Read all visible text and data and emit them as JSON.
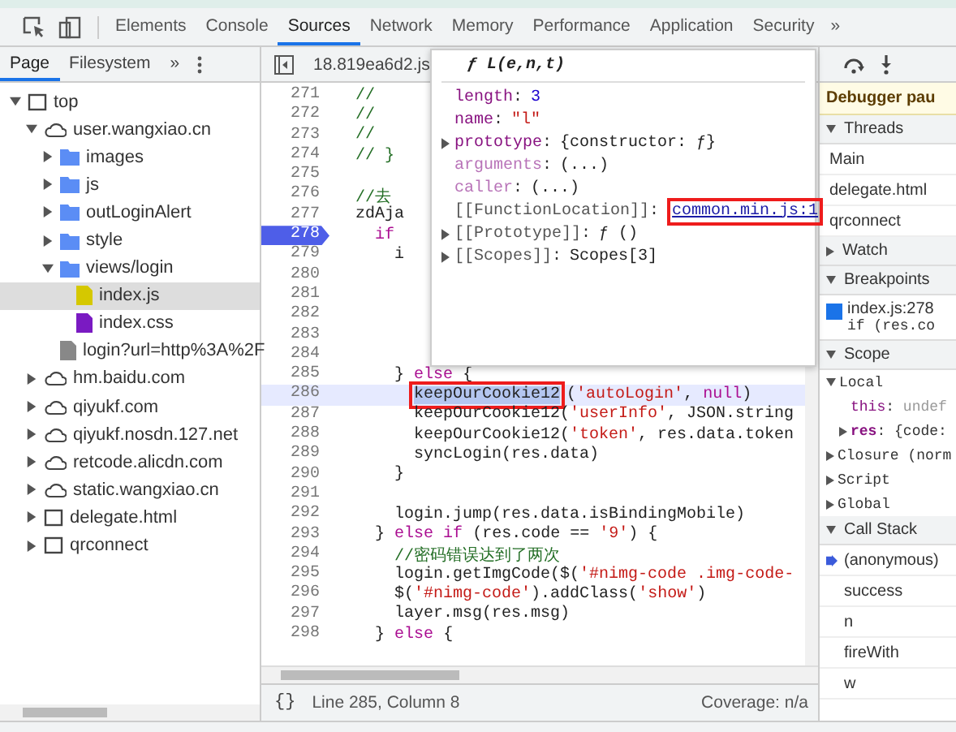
{
  "main_tabs": [
    {
      "label": "Elements",
      "selected": false
    },
    {
      "label": "Console",
      "selected": false
    },
    {
      "label": "Sources",
      "selected": true
    },
    {
      "label": "Network",
      "selected": false
    },
    {
      "label": "Memory",
      "selected": false
    },
    {
      "label": "Performance",
      "selected": false
    },
    {
      "label": "Application",
      "selected": false
    },
    {
      "label": "Security",
      "selected": false
    }
  ],
  "more_tabs": "»",
  "navigator": {
    "tabs": [
      {
        "label": "Page",
        "selected": true
      },
      {
        "label": "Filesystem",
        "selected": false
      }
    ],
    "more": "»",
    "tree": [
      {
        "label": "top",
        "kind": "frame",
        "expanded": true,
        "selected": false,
        "children": [
          {
            "label": "user.wangxiao.cn",
            "kind": "domain",
            "expanded": true,
            "selected": false,
            "children": [
              {
                "label": "images",
                "kind": "folder",
                "expanded": false,
                "selected": false
              },
              {
                "label": "js",
                "kind": "folder",
                "expanded": false,
                "selected": false
              },
              {
                "label": "outLoginAlert",
                "kind": "folder",
                "expanded": false,
                "selected": false
              },
              {
                "label": "style",
                "kind": "folder",
                "expanded": false,
                "selected": false
              },
              {
                "label": "views/login",
                "kind": "folder",
                "expanded": true,
                "selected": false,
                "children": [
                  {
                    "label": "index.js",
                    "kind": "script",
                    "selected": true
                  },
                  {
                    "label": "index.css",
                    "kind": "stylesheet",
                    "selected": false
                  }
                ]
              },
              {
                "label": "login?url=http%3A%2F",
                "kind": "document",
                "selected": false
              }
            ]
          },
          {
            "label": "hm.baidu.com",
            "kind": "domain",
            "expanded": false,
            "selected": false
          },
          {
            "label": "qiyukf.com",
            "kind": "domain",
            "expanded": false,
            "selected": false
          },
          {
            "label": "qiyukf.nosdn.127.net",
            "kind": "domain",
            "expanded": false,
            "selected": false
          },
          {
            "label": "retcode.alicdn.com",
            "kind": "domain",
            "expanded": false,
            "selected": false
          },
          {
            "label": "static.wangxiao.cn",
            "kind": "domain",
            "expanded": false,
            "selected": false
          },
          {
            "label": "delegate.html",
            "kind": "frame",
            "expanded": false,
            "selected": false
          },
          {
            "label": "qrconnect",
            "kind": "frame",
            "expanded": false,
            "selected": false
          }
        ]
      }
    ]
  },
  "editor": {
    "file_tab": "18.819ea6d2.js",
    "lines": [
      {
        "n": "271",
        "breakpoint": false,
        "highlighted": false,
        "tokens": [
          {
            "t": "//",
            "kind": "comment"
          }
        ]
      },
      {
        "n": "272",
        "breakpoint": false,
        "highlighted": false,
        "tokens": [
          {
            "t": "//",
            "kind": "comment"
          }
        ]
      },
      {
        "n": "273",
        "breakpoint": false,
        "highlighted": false,
        "tokens": [
          {
            "t": "//",
            "kind": "comment"
          }
        ]
      },
      {
        "n": "274",
        "breakpoint": false,
        "highlighted": false,
        "tokens": [
          {
            "t": "// }",
            "kind": "comment"
          }
        ]
      },
      {
        "n": "275",
        "breakpoint": false,
        "highlighted": false
      },
      {
        "n": "276",
        "breakpoint": false,
        "highlighted": false,
        "tokens": [
          {
            "t": "//去",
            "kind": "comment"
          }
        ]
      },
      {
        "n": "277",
        "breakpoint": false,
        "highlighted": false,
        "tokens": [
          {
            "t": "zdAja",
            "kind": "plain"
          }
        ]
      },
      {
        "n": "278",
        "breakpoint": true,
        "highlighted": false,
        "tokens": [
          {
            "t": "  if",
            "kind": "keyword"
          }
        ]
      },
      {
        "n": "279",
        "breakpoint": false,
        "highlighted": false,
        "tokens": [
          {
            "t": "    i",
            "kind": "plain"
          }
        ]
      },
      {
        "n": "280",
        "breakpoint": false,
        "highlighted": false
      },
      {
        "n": "281",
        "breakpoint": false,
        "highlighted": false
      },
      {
        "n": "282",
        "breakpoint": false,
        "highlighted": false
      },
      {
        "n": "283",
        "breakpoint": false,
        "highlighted": false
      },
      {
        "n": "284",
        "breakpoint": false,
        "highlighted": false
      },
      {
        "n": "285",
        "breakpoint": false,
        "highlighted": false,
        "tokens": [
          {
            "t": "    } ",
            "kind": "plain"
          },
          {
            "t": "else",
            "kind": "keyword"
          },
          {
            "t": " {",
            "kind": "plain"
          }
        ]
      },
      {
        "n": "286",
        "breakpoint": false,
        "highlighted": true,
        "tokens": [
          {
            "t": "      keepOurCookie12",
            "kind": "plain",
            "text_selected": true,
            "annotated": true
          },
          {
            "t": "(",
            "kind": "plain"
          },
          {
            "t": "'autoLogin'",
            "kind": "string"
          },
          {
            "t": ", ",
            "kind": "plain"
          },
          {
            "t": "null",
            "kind": "keyword"
          },
          {
            "t": ")",
            "kind": "plain"
          }
        ]
      },
      {
        "n": "287",
        "breakpoint": false,
        "highlighted": false,
        "tokens": [
          {
            "t": "      keepOurCookie12(",
            "kind": "plain"
          },
          {
            "t": "'userInfo'",
            "kind": "string"
          },
          {
            "t": ", JSON.string",
            "kind": "plain"
          }
        ]
      },
      {
        "n": "288",
        "breakpoint": false,
        "highlighted": false,
        "tokens": [
          {
            "t": "      keepOurCookie12(",
            "kind": "plain"
          },
          {
            "t": "'token'",
            "kind": "string"
          },
          {
            "t": ", res.data.token",
            "kind": "plain"
          }
        ]
      },
      {
        "n": "289",
        "breakpoint": false,
        "highlighted": false,
        "tokens": [
          {
            "t": "      syncLogin(res.data)",
            "kind": "plain"
          }
        ]
      },
      {
        "n": "290",
        "breakpoint": false,
        "highlighted": false,
        "tokens": [
          {
            "t": "    }",
            "kind": "plain"
          }
        ]
      },
      {
        "n": "291",
        "breakpoint": false,
        "highlighted": false
      },
      {
        "n": "292",
        "breakpoint": false,
        "highlighted": false,
        "tokens": [
          {
            "t": "    login.jump(res.data.isBindingMobile)",
            "kind": "plain"
          }
        ]
      },
      {
        "n": "293",
        "breakpoint": false,
        "highlighted": false,
        "tokens": [
          {
            "t": "  } ",
            "kind": "plain"
          },
          {
            "t": "else if",
            "kind": "keyword"
          },
          {
            "t": " (res.code == ",
            "kind": "plain"
          },
          {
            "t": "'9'",
            "kind": "string"
          },
          {
            "t": ") {",
            "kind": "plain"
          }
        ]
      },
      {
        "n": "294",
        "breakpoint": false,
        "highlighted": false,
        "tokens": [
          {
            "t": "    //密码错误达到了两次",
            "kind": "comment"
          }
        ]
      },
      {
        "n": "295",
        "breakpoint": false,
        "highlighted": false,
        "tokens": [
          {
            "t": "    login.getImgCode($(",
            "kind": "plain"
          },
          {
            "t": "'#nimg-code .img-code-",
            "kind": "string"
          }
        ]
      },
      {
        "n": "296",
        "breakpoint": false,
        "highlighted": false,
        "tokens": [
          {
            "t": "    $(",
            "kind": "plain"
          },
          {
            "t": "'#nimg-code'",
            "kind": "string"
          },
          {
            "t": ").addClass(",
            "kind": "plain"
          },
          {
            "t": "'show'",
            "kind": "string"
          },
          {
            "t": ")",
            "kind": "plain"
          }
        ]
      },
      {
        "n": "297",
        "breakpoint": false,
        "highlighted": false,
        "tokens": [
          {
            "t": "    layer.msg(res.msg)",
            "kind": "plain"
          }
        ]
      },
      {
        "n": "298",
        "breakpoint": false,
        "highlighted": false,
        "tokens": [
          {
            "t": "  } ",
            "kind": "plain"
          },
          {
            "t": "else",
            "kind": "keyword"
          },
          {
            "t": " {",
            "kind": "plain"
          }
        ]
      }
    ],
    "pretty_print": "{}",
    "position": "Line 285, Column 8",
    "coverage": "Coverage: n/a"
  },
  "popover": {
    "title": "ƒ L(e,n,t)",
    "entries": [
      {
        "key": "length",
        "kind": "own",
        "expandable": false,
        "separator": ":",
        "value": {
          "text": "3",
          "kind": "number"
        }
      },
      {
        "key": "name",
        "kind": "own",
        "expandable": false,
        "separator": ":",
        "value": {
          "text": "\"l\"",
          "kind": "string"
        }
      },
      {
        "key": "prototype",
        "kind": "own",
        "expandable": true,
        "separator": ":",
        "value": {
          "text": "{constructor: ƒ}",
          "kind": "plain"
        }
      },
      {
        "key": "arguments",
        "kind": "accessor",
        "expandable": false,
        "separator": ":",
        "value": {
          "text": "(...)",
          "kind": "plain"
        }
      },
      {
        "key": "caller",
        "kind": "accessor",
        "expandable": false,
        "separator": ":",
        "value": {
          "text": "(...)",
          "kind": "plain"
        }
      },
      {
        "key": "[[FunctionLocation]]",
        "kind": "internal",
        "expandable": false,
        "separator": ":",
        "value": {
          "text": "common.min.js:1",
          "kind": "link",
          "annotated": true
        }
      },
      {
        "key": "[[Prototype]]",
        "kind": "internal",
        "expandable": true,
        "separator": ":",
        "value": {
          "text": "ƒ ()",
          "kind": "plain"
        }
      },
      {
        "key": "[[Scopes]]",
        "kind": "internal",
        "expandable": true,
        "separator": ":",
        "value": {
          "text": "Scopes[3]",
          "kind": "plain"
        }
      }
    ]
  },
  "debugger": {
    "banner": "Debugger pau",
    "sections": [
      {
        "kind": "list",
        "title": "Threads",
        "expanded": true,
        "items": [
          {
            "label": "Main",
            "selected": false
          },
          {
            "label": "delegate.html",
            "selected": false
          },
          {
            "label": "qrconnect",
            "selected": false
          }
        ]
      },
      {
        "title": "Watch",
        "expanded": false
      },
      {
        "kind": "breakpoints",
        "title": "Breakpoints",
        "expanded": true,
        "items": [
          {
            "label": "index.js:278",
            "code": "if (res.co",
            "checked": true
          }
        ]
      },
      {
        "kind": "scope",
        "title": "Scope",
        "expanded": true,
        "items": [
          {
            "label": "Local",
            "expanded": true,
            "children": [
              {
                "key": "this",
                "separator": ":",
                "value": "undef",
                "expandable": false
              },
              {
                "key": "res",
                "separator": ":",
                "value": "{code:",
                "expandable": true
              }
            ]
          },
          {
            "label": "Closure (norm",
            "expanded": false
          },
          {
            "label": "Script",
            "expanded": false
          },
          {
            "label": "Global",
            "expanded": false
          }
        ]
      },
      {
        "kind": "callstack",
        "title": "Call Stack",
        "expanded": true,
        "items": [
          {
            "label": "(anonymous)",
            "selected": true
          },
          {
            "label": "success",
            "selected": false
          },
          {
            "label": "n",
            "selected": false
          },
          {
            "label": "fireWith",
            "selected": false
          },
          {
            "label": "w",
            "selected": false
          }
        ]
      }
    ]
  }
}
